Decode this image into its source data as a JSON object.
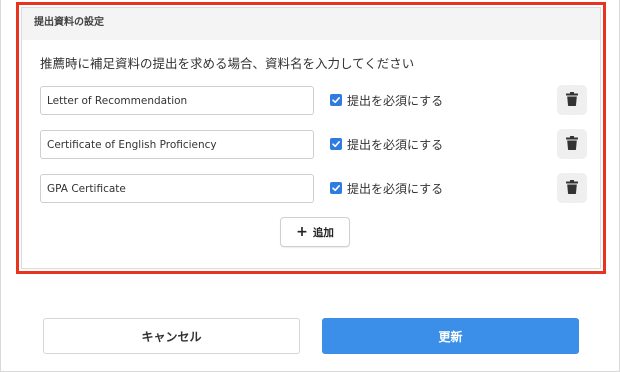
{
  "section": {
    "title": "提出資料の設定",
    "instruction": "推薦時に補足資料の提出を求める場合、資料名を入力してください",
    "documents": [
      {
        "name": "Letter of Recommendation",
        "required_label": "提出を必須にする",
        "required": true
      },
      {
        "name": "Certificate of English Proficiency",
        "required_label": "提出を必須にする",
        "required": true
      },
      {
        "name": "GPA Certificate",
        "required_label": "提出を必須にする",
        "required": true
      }
    ],
    "add_label": "追加"
  },
  "footer": {
    "cancel_label": "キャンセル",
    "update_label": "更新"
  },
  "colors": {
    "highlight_border": "#e8331f",
    "primary": "#3b8fe8",
    "checkbox": "#2f7be0"
  },
  "icons": {
    "delete": "trash-icon",
    "add": "plus-icon",
    "checkbox": "checkmark-icon"
  }
}
